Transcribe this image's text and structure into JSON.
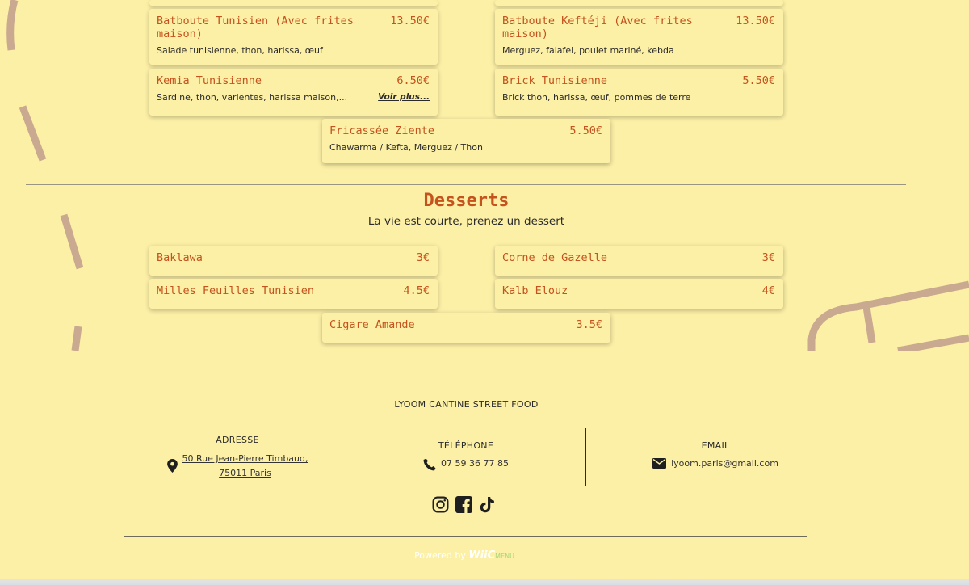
{
  "mains": {
    "items": [
      {
        "name": "Batboute Tunisien (Avec frites maison)",
        "price": "13.50€",
        "desc": "Salade tunisienne, thon, harissa, œuf"
      },
      {
        "name": "Batboute Keftéji (Avec frites maison)",
        "price": "13.50€",
        "desc": "Merguez, falafel, poulet mariné, kebda"
      },
      {
        "name": "Kemia Tunisienne",
        "price": "6.50€",
        "desc": "Sardine, thon, varientes, harissa maison,...",
        "more": "Voir plus..."
      },
      {
        "name": "Brick Tunisienne",
        "price": "5.50€",
        "desc": "Brick thon, harissa, œuf, pommes de terre"
      },
      {
        "name": "Fricassée Ziente",
        "price": "5.50€",
        "desc": "Chawarma / Kefta, Merguez / Thon"
      }
    ]
  },
  "desserts": {
    "title": "Desserts",
    "subtitle": "La vie est courte, prenez un dessert",
    "items": [
      {
        "name": "Baklawa",
        "price": "3€"
      },
      {
        "name": "Corne de Gazelle",
        "price": "3€"
      },
      {
        "name": "Milles Feuilles Tunisien",
        "price": "4.5€"
      },
      {
        "name": "Kalb Elouz",
        "price": "4€"
      },
      {
        "name": "Cigare Amande",
        "price": "3.5€"
      }
    ]
  },
  "footer": {
    "brand": "LYOOM CANTINE STREET FOOD",
    "address": {
      "head": "ADRESSE",
      "line1": "50 Rue Jean-Pierre Timbaud,",
      "line2": "75011 Paris"
    },
    "phone": {
      "head": "TÉLÉPHONE",
      "value": "07 59 36 77 85"
    },
    "email": {
      "head": "EMAIL",
      "value": "lyoom.paris@gmail.com"
    },
    "social_icons": [
      "instagram-icon",
      "facebook-icon",
      "tiktok-icon"
    ],
    "powered": {
      "prefix": "Powered by",
      "logo": "WiiC",
      "suffix": "MENU"
    }
  },
  "colors": {
    "background": "#fcefa6",
    "accent": "#c4531d",
    "text": "#2b2b2b"
  }
}
